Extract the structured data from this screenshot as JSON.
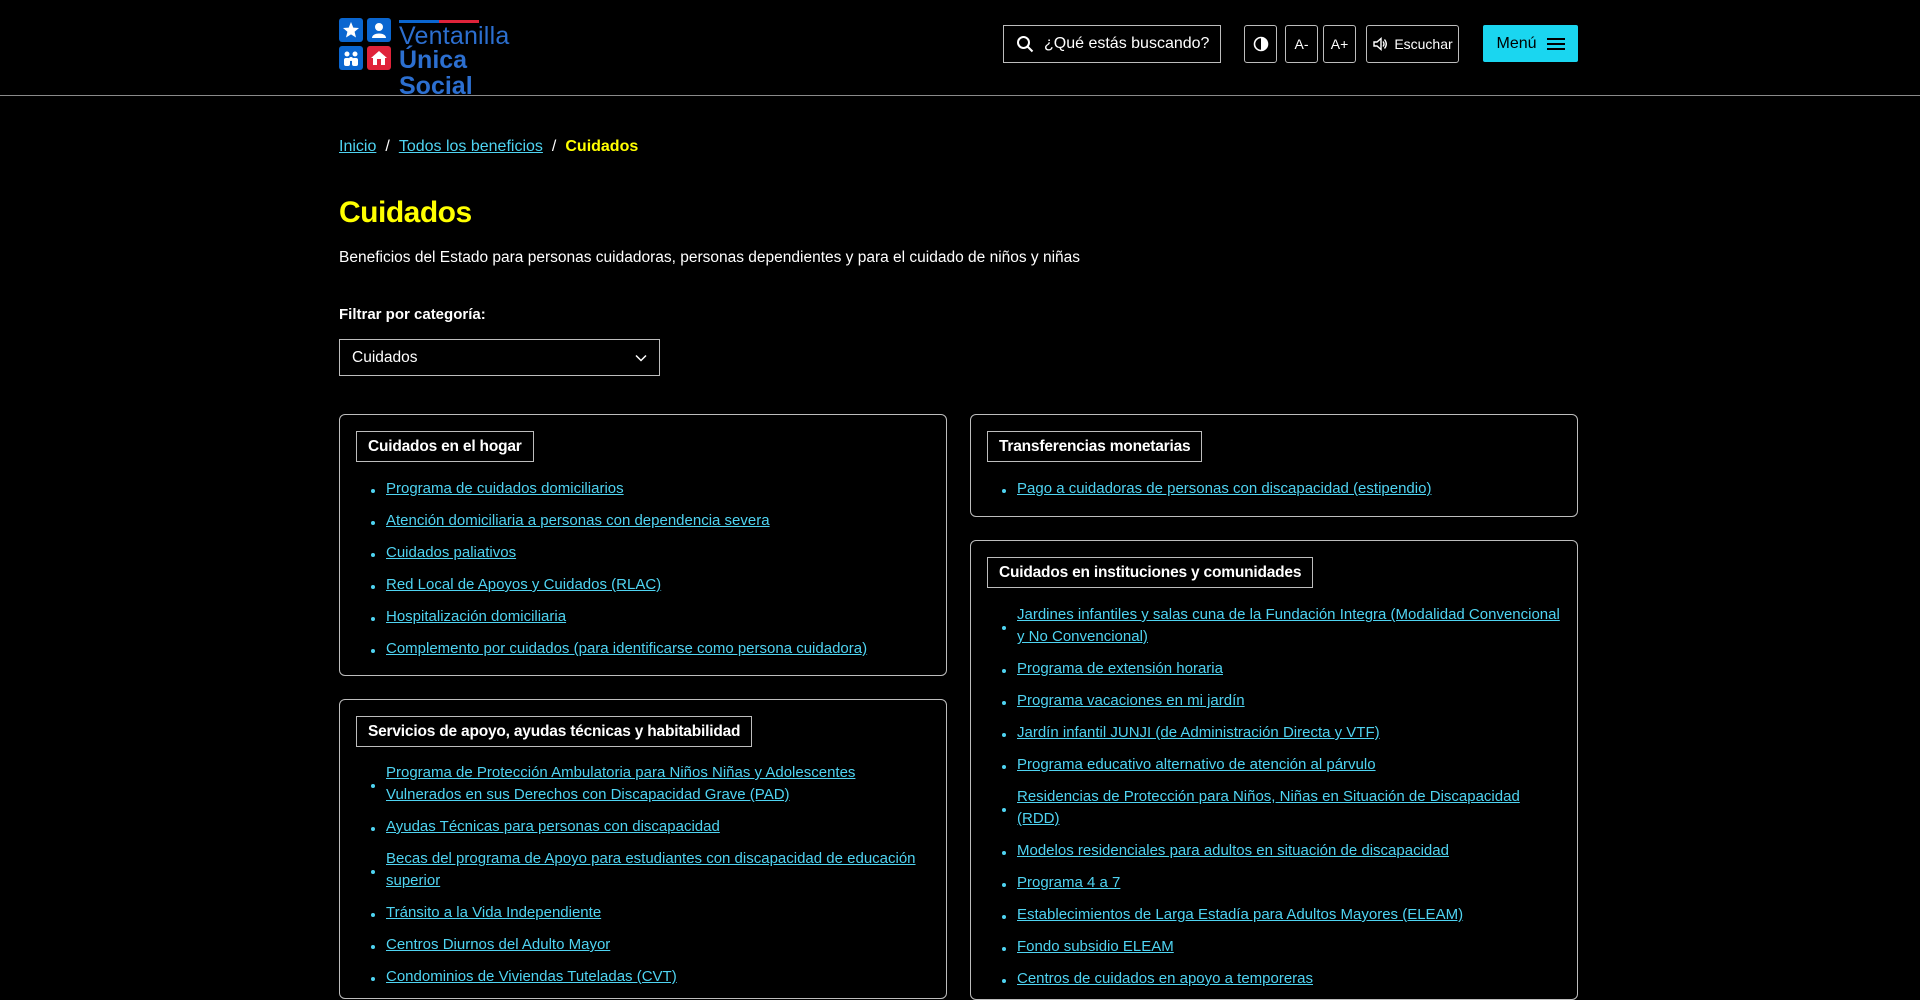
{
  "header": {
    "logo": {
      "line1": "Ventanilla",
      "line2": "Única Social"
    },
    "search": {
      "placeholder": "¿Qué estás buscando?"
    },
    "tools": {
      "font_decrease": "A-",
      "font_increase": "A+",
      "listen": "Escuchar"
    },
    "menu_label": "Menú"
  },
  "breadcrumb": {
    "home": "Inicio",
    "all": "Todos los beneficios",
    "current": "Cuidados",
    "separator": "/"
  },
  "page": {
    "title": "Cuidados",
    "description": "Beneficios del Estado para personas cuidadoras, personas dependientes y para el cuidado de niños y niñas",
    "filter_label": "Filtrar por categoría:",
    "filter_value": "Cuidados"
  },
  "cards": {
    "hogar": {
      "title": "Cuidados en el hogar",
      "items": [
        "Programa de cuidados domiciliarios",
        "Atención domiciliaria a personas con dependencia severa",
        "Cuidados paliativos",
        "Red Local de Apoyos y Cuidados (RLAC)",
        "Hospitalización domiciliaria",
        "Complemento por cuidados (para identificarse como persona cuidadora)"
      ]
    },
    "apoyo": {
      "title": "Servicios de apoyo, ayudas técnicas y habitabilidad",
      "items": [
        "Programa de Protección Ambulatoria para Niños Niñas y Adolescentes Vulnerados en sus Derechos con Discapacidad Grave (PAD)",
        "Ayudas Técnicas para personas con discapacidad",
        "Becas del programa de Apoyo para estudiantes con discapacidad de educación superior",
        "Tránsito a la Vida Independiente",
        "Centros Diurnos del Adulto Mayor",
        "Condominios de Viviendas Tuteladas (CVT)"
      ]
    },
    "transferencias": {
      "title": "Transferencias monetarias",
      "items": [
        "Pago a cuidadoras de personas con discapacidad (estipendio)"
      ]
    },
    "instituciones": {
      "title": "Cuidados en instituciones y comunidades",
      "items": [
        "Jardines infantiles y salas cuna de la Fundación Integra (Modalidad Convencional y No Convencional)",
        "Programa de extensión horaria",
        "Programa vacaciones en mi jardín",
        "Jardín infantil JUNJI (de Administración Directa y VTF)",
        "Programa educativo alternativo de atención al párvulo",
        "Residencias de Protección para Niños, Niñas en Situación de Discapacidad (RDD)",
        "Modelos residenciales para adultos en situación de discapacidad",
        "Programa 4 a 7",
        "Establecimientos de Larga Estadía para Adultos Mayores (ELEAM)",
        "Fondo subsidio ELEAM",
        "Centros de cuidados en apoyo a temporeras"
      ]
    }
  },
  "colors": {
    "accent_link": "#4fd4f2",
    "title_yellow": "#ffff00",
    "menu_button": "#1ad6f0",
    "logo_blue": "#0a66d0",
    "logo_red": "#e0233a"
  }
}
